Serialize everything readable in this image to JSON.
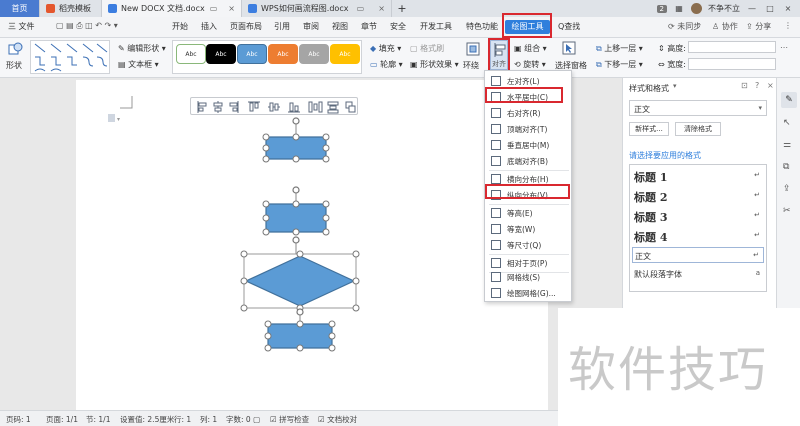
{
  "tabs": {
    "home": "首页",
    "t1": "稻壳模板",
    "t2": "New DOCX 文档.docx",
    "t3": "WPS如何画流程图.docx",
    "plus": "+",
    "badge": "2",
    "user": "不争不立"
  },
  "menu": {
    "file": "三 文件",
    "items": [
      "开始",
      "插入",
      "页面布局",
      "引用",
      "审阅",
      "视图",
      "章节",
      "安全",
      "开发工具",
      "特色功能"
    ],
    "active": "绘图工具",
    "search": "Q查找",
    "sync": "未同步",
    "collab": "协作",
    "share": "分享"
  },
  "ribbon": {
    "shape": "形状",
    "edit_shape": "编辑形状",
    "textbox": "文本框",
    "swatch_label": "Abc",
    "fill": "填充",
    "format_brush": "格式刷",
    "outline": "轮廓",
    "shape_effect": "形状效果",
    "wrap": "环绕",
    "align": "对齐",
    "group": "组合",
    "rotate": "旋转",
    "select_pane": "选择窗格",
    "bring_forward": "上移一层",
    "send_backward": "下移一层",
    "height": "高度:",
    "width": "宽度:"
  },
  "dropdown": {
    "items": [
      "左对齐(L)",
      "水平居中(C)",
      "右对齐(R)",
      "顶端对齐(T)",
      "垂直居中(M)",
      "底端对齐(B)",
      "横向分布(H)",
      "纵向分布(V)",
      "等高(E)",
      "等宽(W)",
      "等尺寸(Q)",
      "相对于页(P)",
      "网格线(S)",
      "绘图网格(G)..."
    ]
  },
  "panel": {
    "title": "样式和格式",
    "current_style": "正文",
    "new_style": "新样式...",
    "clear_format": "清除格式",
    "prompt": "请选择要应用的格式",
    "styles": [
      "标题 1",
      "标题 2",
      "标题 3",
      "标题 4",
      "正文",
      "默认段落字体"
    ]
  },
  "status": {
    "page": "页码: 1",
    "pages": "页面: 1/1",
    "section": "节: 1/1",
    "setting": "设置值: 2.5厘米",
    "row": "行: 1",
    "col": "列: 1",
    "words": "字数: 0",
    "spell": "拼写检查",
    "proof": "文档校对"
  },
  "watermark": "软件技巧",
  "colors": {
    "accent": "#2f7fdc",
    "highlight": "#d9282f",
    "shape_fill": "#5b9bd5",
    "shape_stroke": "#41719c"
  }
}
